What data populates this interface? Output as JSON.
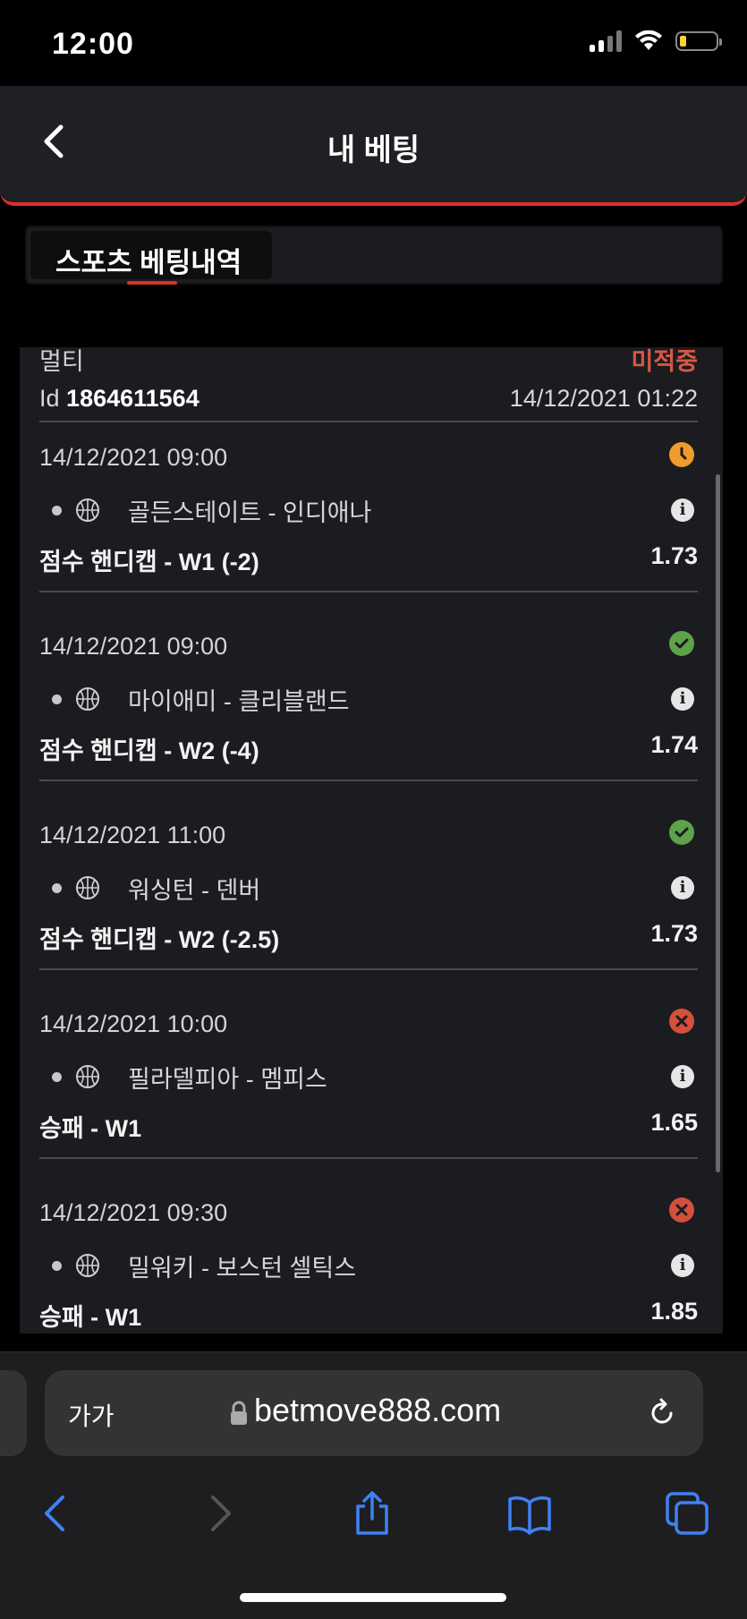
{
  "status_bar": {
    "time": "12:00"
  },
  "header": {
    "title": "내 베팅"
  },
  "tabs": {
    "active_label": "스포츠 베팅내역"
  },
  "bet": {
    "type": "멀티",
    "status": "미적중",
    "id_prefix": "Id",
    "id": "1864611564",
    "placed_at": "14/12/2021 01:22",
    "events": [
      {
        "time": "14/12/2021 09:00",
        "status_icon": "clock-icon",
        "match": "골든스테이트 - 인디애나",
        "market": "점수 핸디캡 - W1 (-2)",
        "odds": "1.73"
      },
      {
        "time": "14/12/2021 09:00",
        "status_icon": "check-icon",
        "match": "마이애미 - 클리블랜드",
        "market": "점수 핸디캡 - W2 (-4)",
        "odds": "1.74"
      },
      {
        "time": "14/12/2021 11:00",
        "status_icon": "check-icon",
        "match": "워싱턴 - 덴버",
        "market": "점수 핸디캡 - W2 (-2.5)",
        "odds": "1.73"
      },
      {
        "time": "14/12/2021 10:00",
        "status_icon": "cross-icon",
        "match": "필라델피아 - 멤피스",
        "market": "승패 - W1",
        "odds": "1.65"
      },
      {
        "time": "14/12/2021 09:30",
        "status_icon": "cross-icon",
        "match": "밀워키 - 보스턴 셀틱스",
        "market": "승패 - W1",
        "odds": "1.85"
      }
    ]
  },
  "browser": {
    "text_size_label": "가가",
    "url": "betmove888.com"
  },
  "colors": {
    "accent": "#d9302d",
    "loss": "#d65845",
    "won": "#5ea24a",
    "pending": "#f09b2e"
  }
}
